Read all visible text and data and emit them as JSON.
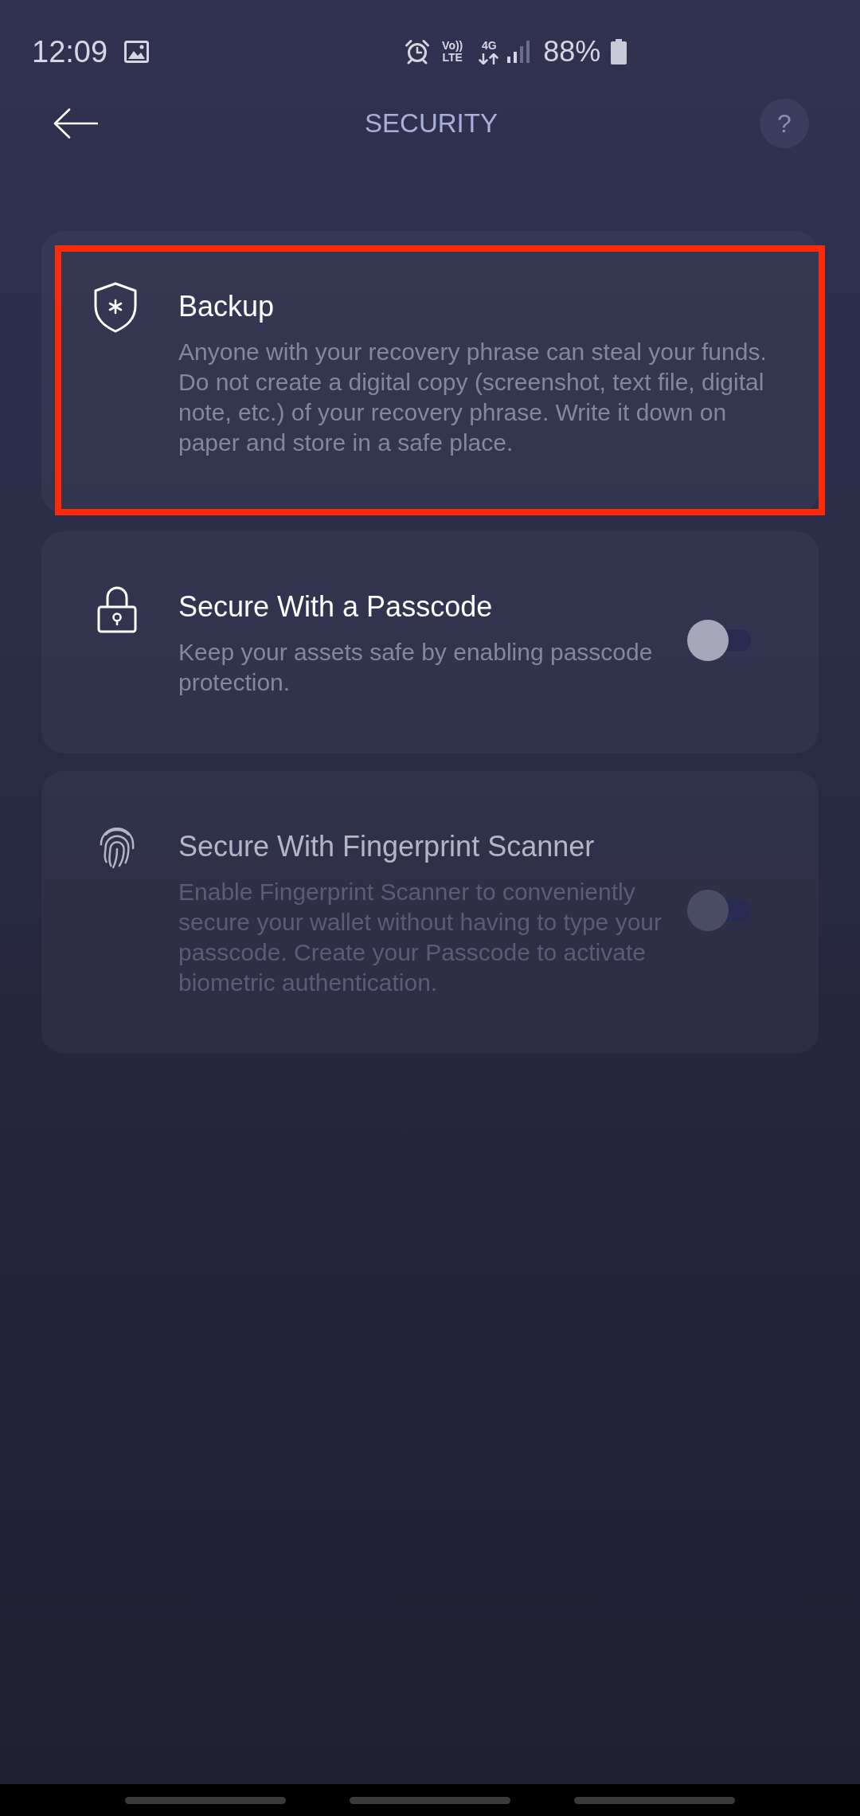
{
  "status_bar": {
    "time": "12:09",
    "volte_top": "Vo))",
    "volte_bottom": "LTE",
    "network": "4G",
    "battery": "88%"
  },
  "header": {
    "title": "SECURITY",
    "help_label": "?"
  },
  "items": [
    {
      "kind": "backup",
      "title": "Backup",
      "description": "Anyone with your recovery phrase can steal your funds. Do not create a digital copy (screenshot, text file, digital note, etc.) of your recovery phrase. Write it down on paper and store in a safe place.",
      "highlighted": true,
      "disabled": false
    },
    {
      "kind": "passcode",
      "title": "Secure With a Passcode",
      "description": "Keep your assets safe by enabling passcode protection.",
      "on": false,
      "highlighted": false,
      "disabled": false
    },
    {
      "kind": "biometric",
      "title": "Secure With Fingerprint Scanner",
      "description": "Enable Fingerprint Scanner to conveniently secure your wallet without having to type your passcode. Create your Passcode to activate biometric authentication.",
      "on": false,
      "highlighted": false,
      "disabled": true
    }
  ]
}
